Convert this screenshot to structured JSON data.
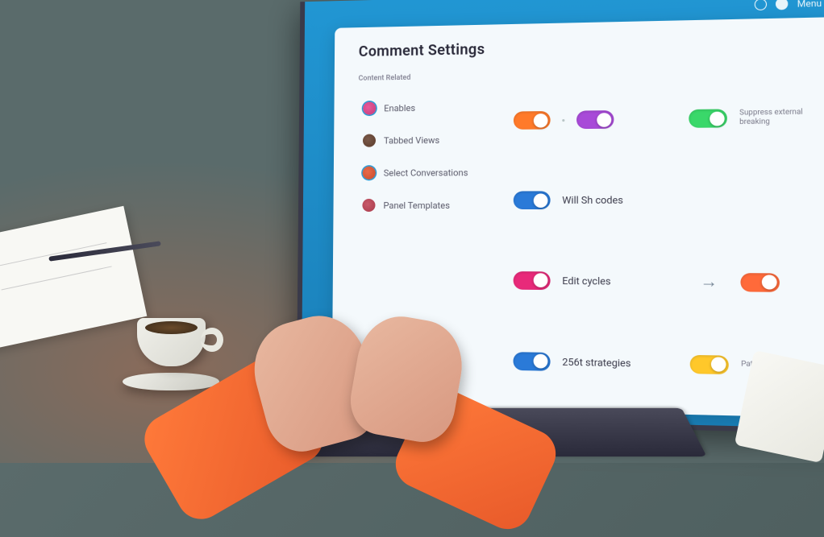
{
  "header": {
    "menu_label": "Menu"
  },
  "panel": {
    "title": "Comment Settings"
  },
  "sidebar": {
    "heading": "Content Related",
    "items": [
      {
        "label": "Enables"
      },
      {
        "label": "Tabbed Views"
      },
      {
        "label": "Select Conversations"
      },
      {
        "label": "Panel Templates"
      }
    ]
  },
  "settings": {
    "row1_left_a": {
      "color": "orange",
      "on": true
    },
    "row1_left_b": {
      "color": "purple",
      "on": true
    },
    "row1_right": {
      "color": "green",
      "on": true,
      "sublabel": "Suppress external breaking"
    },
    "row2_left": {
      "color": "blue",
      "on": false,
      "label": "Will Sh codes"
    },
    "row3_left": {
      "color": "magenta",
      "on": true,
      "label": "Edit cycles"
    },
    "row3_right": {
      "color": "orange2",
      "on": true
    },
    "row4_left": {
      "color": "blue",
      "on": true,
      "label": "256t strategies"
    },
    "row4_right": {
      "color": "yellow",
      "on": true,
      "sublabel": "Patient Variant"
    }
  }
}
